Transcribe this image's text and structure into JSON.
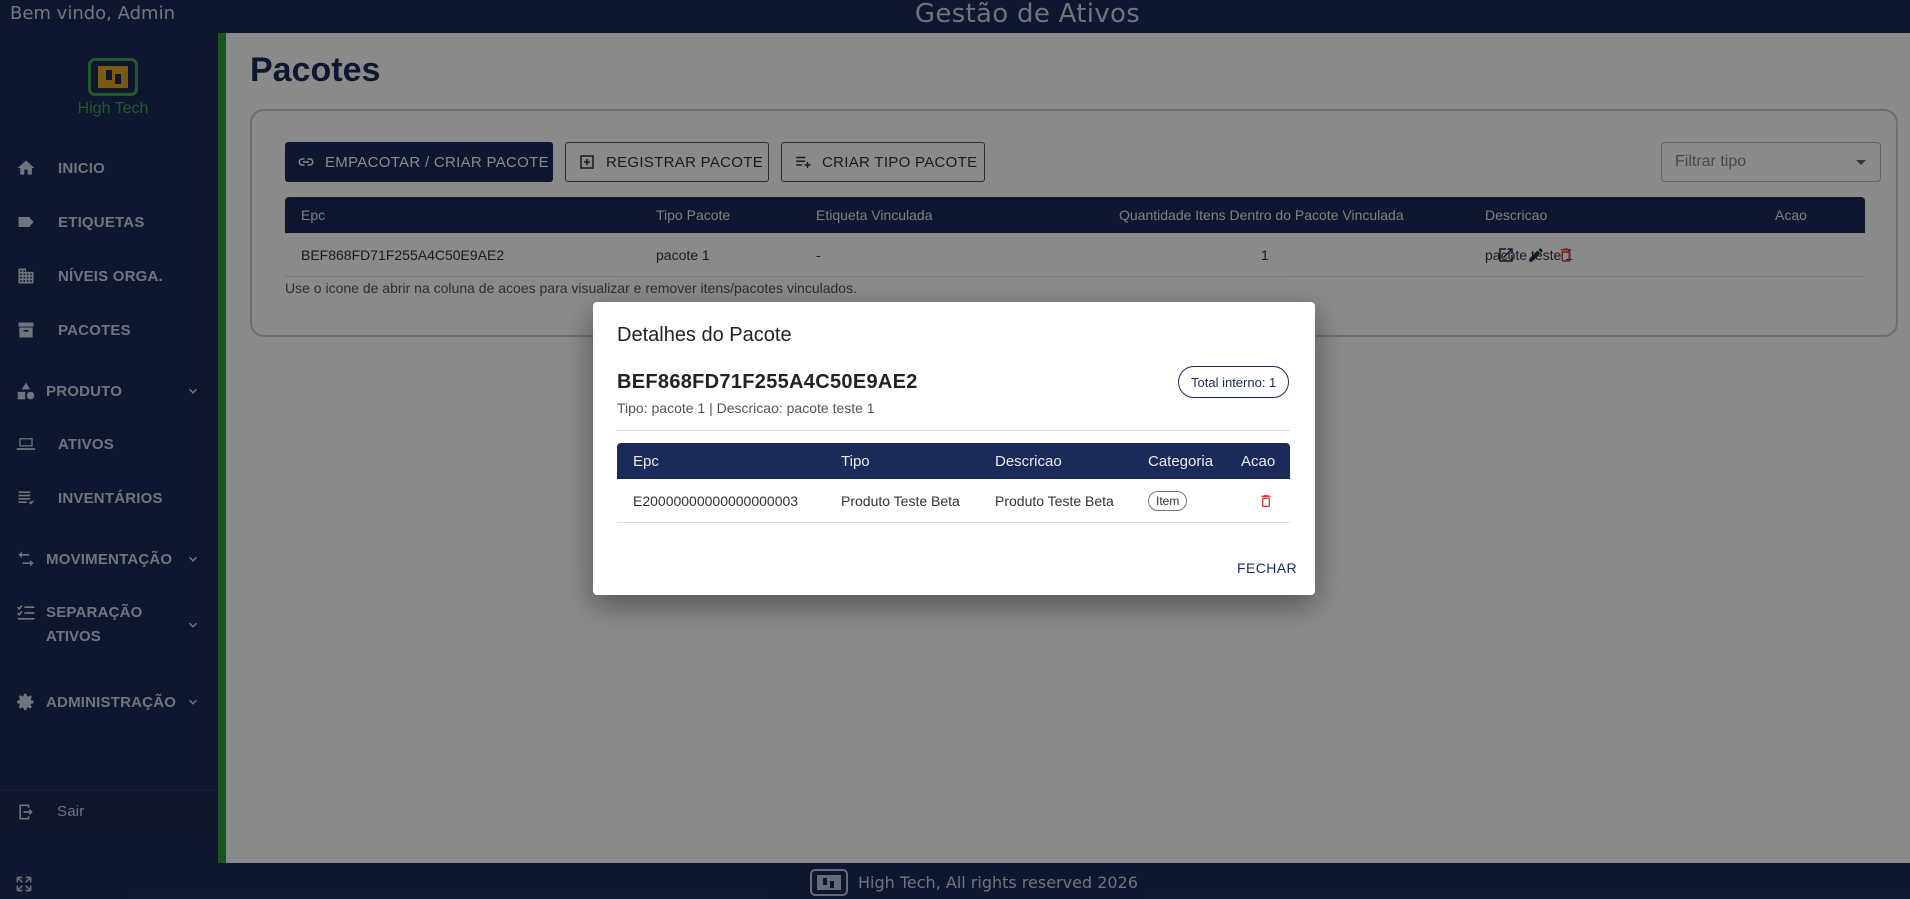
{
  "topbar": {
    "welcome": "Bem vindo, Admin",
    "title": "Gestão de Ativos"
  },
  "sidebar": {
    "logo_text": "High Tech",
    "items": [
      {
        "label": "INICIO",
        "icon": "home-icon"
      },
      {
        "label": "ETIQUETAS",
        "icon": "tag-icon"
      },
      {
        "label": "NÍVEIS ORGA.",
        "icon": "building-icon"
      },
      {
        "label": "PACOTES",
        "icon": "archive-icon"
      },
      {
        "label": "PRODUTO",
        "icon": "shapes-icon"
      },
      {
        "label": "ATIVOS",
        "icon": "laptop-icon"
      },
      {
        "label": "INVENTÁRIOS",
        "icon": "list-icon"
      },
      {
        "label": "MOVIMENTAÇÃO",
        "icon": "swap-icon"
      },
      {
        "label": "SEPARAÇÃO",
        "label2": "ATIVOS",
        "icon": "checklist-icon"
      },
      {
        "label": "ADMINISTRAÇÃO",
        "icon": "gear-icon"
      }
    ],
    "logout": "Sair"
  },
  "main": {
    "title": "Pacotes",
    "buttons": {
      "pack": "EMPACOTAR / CRIAR PACOTE",
      "register": "REGISTRAR PACOTE",
      "create_type": "CRIAR TIPO PACOTE"
    },
    "filter_placeholder": "Filtrar tipo",
    "table": {
      "headers": [
        "Epc",
        "Tipo Pacote",
        "Etiqueta Vinculada",
        "Quantidade Itens Dentro do Pacote Vinculada",
        "Descricao",
        "Acao"
      ],
      "rows": [
        {
          "epc": "BEF868FD71F255A4C50E9AE2",
          "tipo": "pacote 1",
          "etiqueta": "-",
          "quantidade": "1",
          "descricao": "pacote teste 1"
        }
      ]
    },
    "hint": "Use o icone de abrir na coluna de acoes para visualizar e remover itens/pacotes vinculados."
  },
  "footer": {
    "text": "High Tech, All rights reserved 2026"
  },
  "dialog": {
    "title": "Detalhes do Pacote",
    "epc": "BEF868FD71F255A4C50E9AE2",
    "subtitle": "Tipo: pacote 1 | Descricao: pacote teste 1",
    "total_badge": "Total interno: 1",
    "table": {
      "headers": [
        "Epc",
        "Tipo",
        "Descricao",
        "Categoria",
        "Acao"
      ],
      "rows": [
        {
          "epc": "E20000000000000000003",
          "tipo": "Produto Teste Beta",
          "descricao": "Produto Teste Beta",
          "categoria": "Item"
        }
      ]
    },
    "close_label": "FECHAR"
  },
  "colors": {
    "navy": "#1c2a5a",
    "green": "#2e9e3e",
    "gold": "#e5a521",
    "danger": "#e53935"
  }
}
